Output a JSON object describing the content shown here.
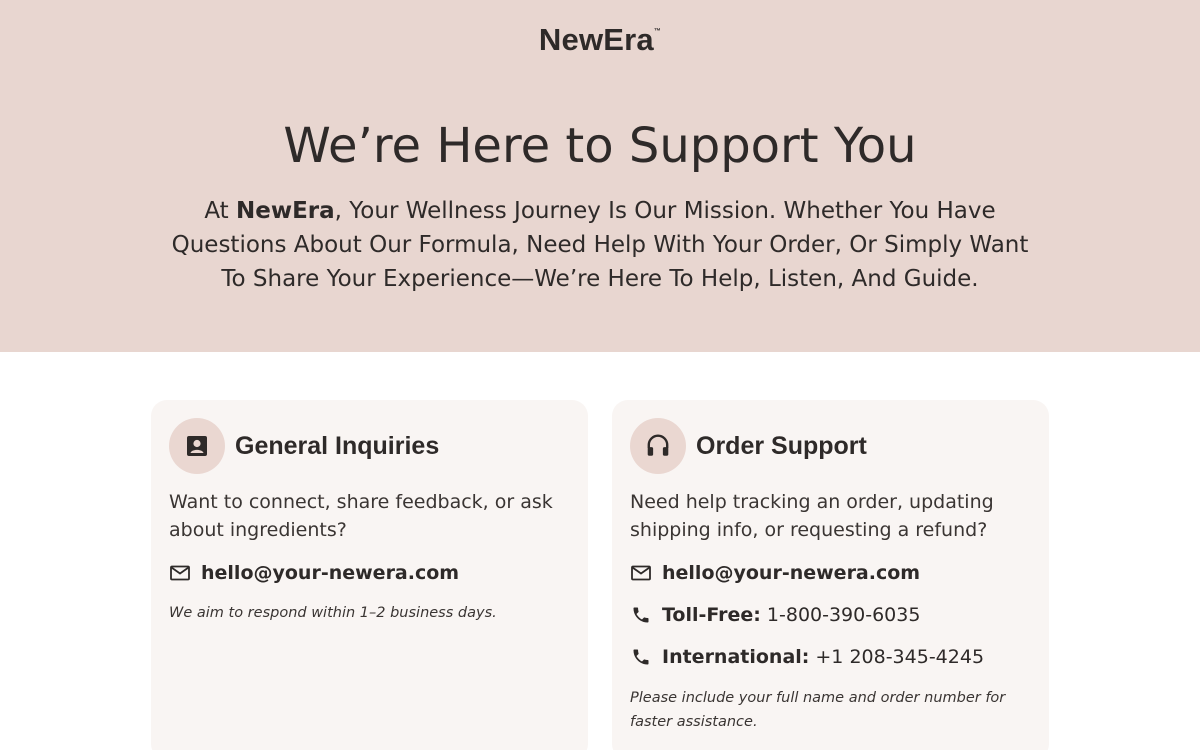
{
  "brand": {
    "name": "NewEra",
    "trademark": "™"
  },
  "hero": {
    "title": "We’re Here to Support You",
    "desc_prefix": "At ",
    "desc_brand": "NewEra",
    "desc_rest": ", Your Wellness Journey Is Our Mission. Whether You Have Questions About Our Formula, Need Help With Your Order, Or Simply Want To Share Your Experience—We’re Here To Help, Listen, And Guide."
  },
  "cards": {
    "general": {
      "icon": "contact-card-icon",
      "title": "General Inquiries",
      "description": "Want to connect, share feedback, or ask about ingredients?",
      "email": "hello@your-newera.com",
      "note": "We aim to respond within 1–2 business days."
    },
    "order": {
      "icon": "headset-icon",
      "title": "Order Support",
      "description": "Need help tracking an order, updating shipping info, or requesting a refund?",
      "email": "hello@your-newera.com",
      "tollfree_label": "Toll-Free:",
      "tollfree_number": "1-800-390-6035",
      "intl_label": "International:",
      "intl_number": "+1 208-345-4245",
      "note": "Please include your full name and order number for faster assistance."
    }
  },
  "colors": {
    "hero_bg": "#e8d6d0",
    "card_bg": "#f9f5f3",
    "icon_circle": "#ead7d1",
    "text": "#2e2a29"
  }
}
